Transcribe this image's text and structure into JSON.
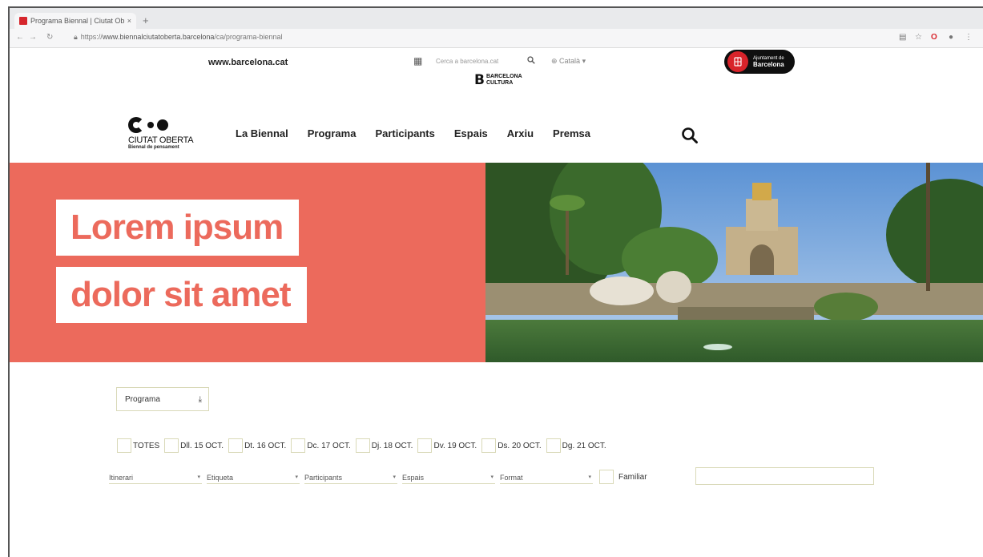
{
  "browser": {
    "tab_title": "Programa Biennal | Ciutat Obe",
    "tab_close": "×",
    "new_tab": "+",
    "url_scheme": "https://",
    "url_host": "www.biennalciutatoberta.barcelona",
    "url_path": "/ca/programa-biennal",
    "ext_icons": [
      "reader-icon",
      "star-icon",
      "opera-icon",
      "account-icon",
      "menu-icon"
    ]
  },
  "topbar": {
    "city_link": "www.barcelona.cat",
    "search_placeholder": "Cerca a barcelona.cat",
    "language": "Català",
    "brand_line1": "BARCELONA",
    "brand_line2": "CULTURA",
    "ajuntament_line1": "Ajuntament de",
    "ajuntament_line2": "Barcelona"
  },
  "nav": {
    "logo_name": "CIUTAT OBERTA",
    "logo_sub": "Biennal de pensament",
    "items": [
      "La Biennal",
      "Programa",
      "Participants",
      "Espais",
      "Arxiu",
      "Premsa"
    ]
  },
  "hero": {
    "line1": "Lorem ipsum",
    "line2": "dolor sit amet",
    "colors": {
      "accent": "#ec6a5c"
    }
  },
  "filters": {
    "program_select": "Programa",
    "days": [
      "TOTES",
      "Dll. 15 OCT.",
      "Dt. 16 OCT.",
      "Dc. 17 OCT.",
      "Dj. 18 OCT.",
      "Dv. 19 OCT.",
      "Ds. 20 OCT.",
      "Dg. 21 OCT."
    ],
    "dropdowns": [
      "Itinerari",
      "Etiqueta",
      "Participants",
      "Espais",
      "Format"
    ],
    "family_label": "Familiar",
    "free_text": ""
  }
}
